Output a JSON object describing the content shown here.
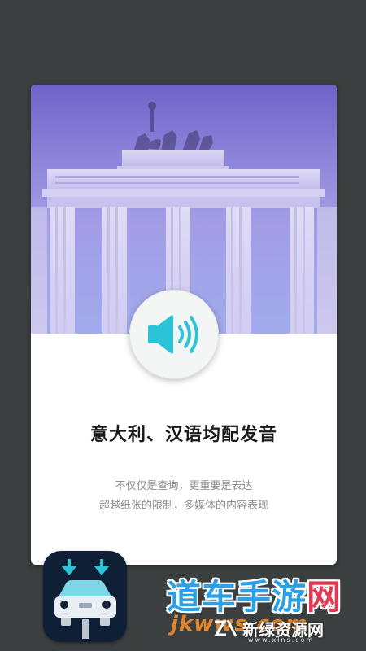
{
  "card": {
    "headline": "意大利、汉语均配发音",
    "description_line1": "不仅仅是查询，更重要是表达",
    "description_line2": "超越纸张的限制，多媒体的内容表现",
    "hero_image": "brandenburg-gate-photo",
    "speaker_icon": "speaker-volume-icon"
  },
  "watermark": {
    "main_blue": "道车手游",
    "main_red": "网",
    "url": "jkwws.com",
    "sub": "新绿资源网",
    "small": "www.xlns.com"
  },
  "colors": {
    "background": "#3b3f3f",
    "card": "#ffffff",
    "speaker_accent": "#2bc3d6",
    "hero_tint": "#8f7fe0",
    "watermark_blue": "#2da0e3",
    "watermark_red": "#e03a54",
    "watermark_orange": "#f08a2a"
  }
}
